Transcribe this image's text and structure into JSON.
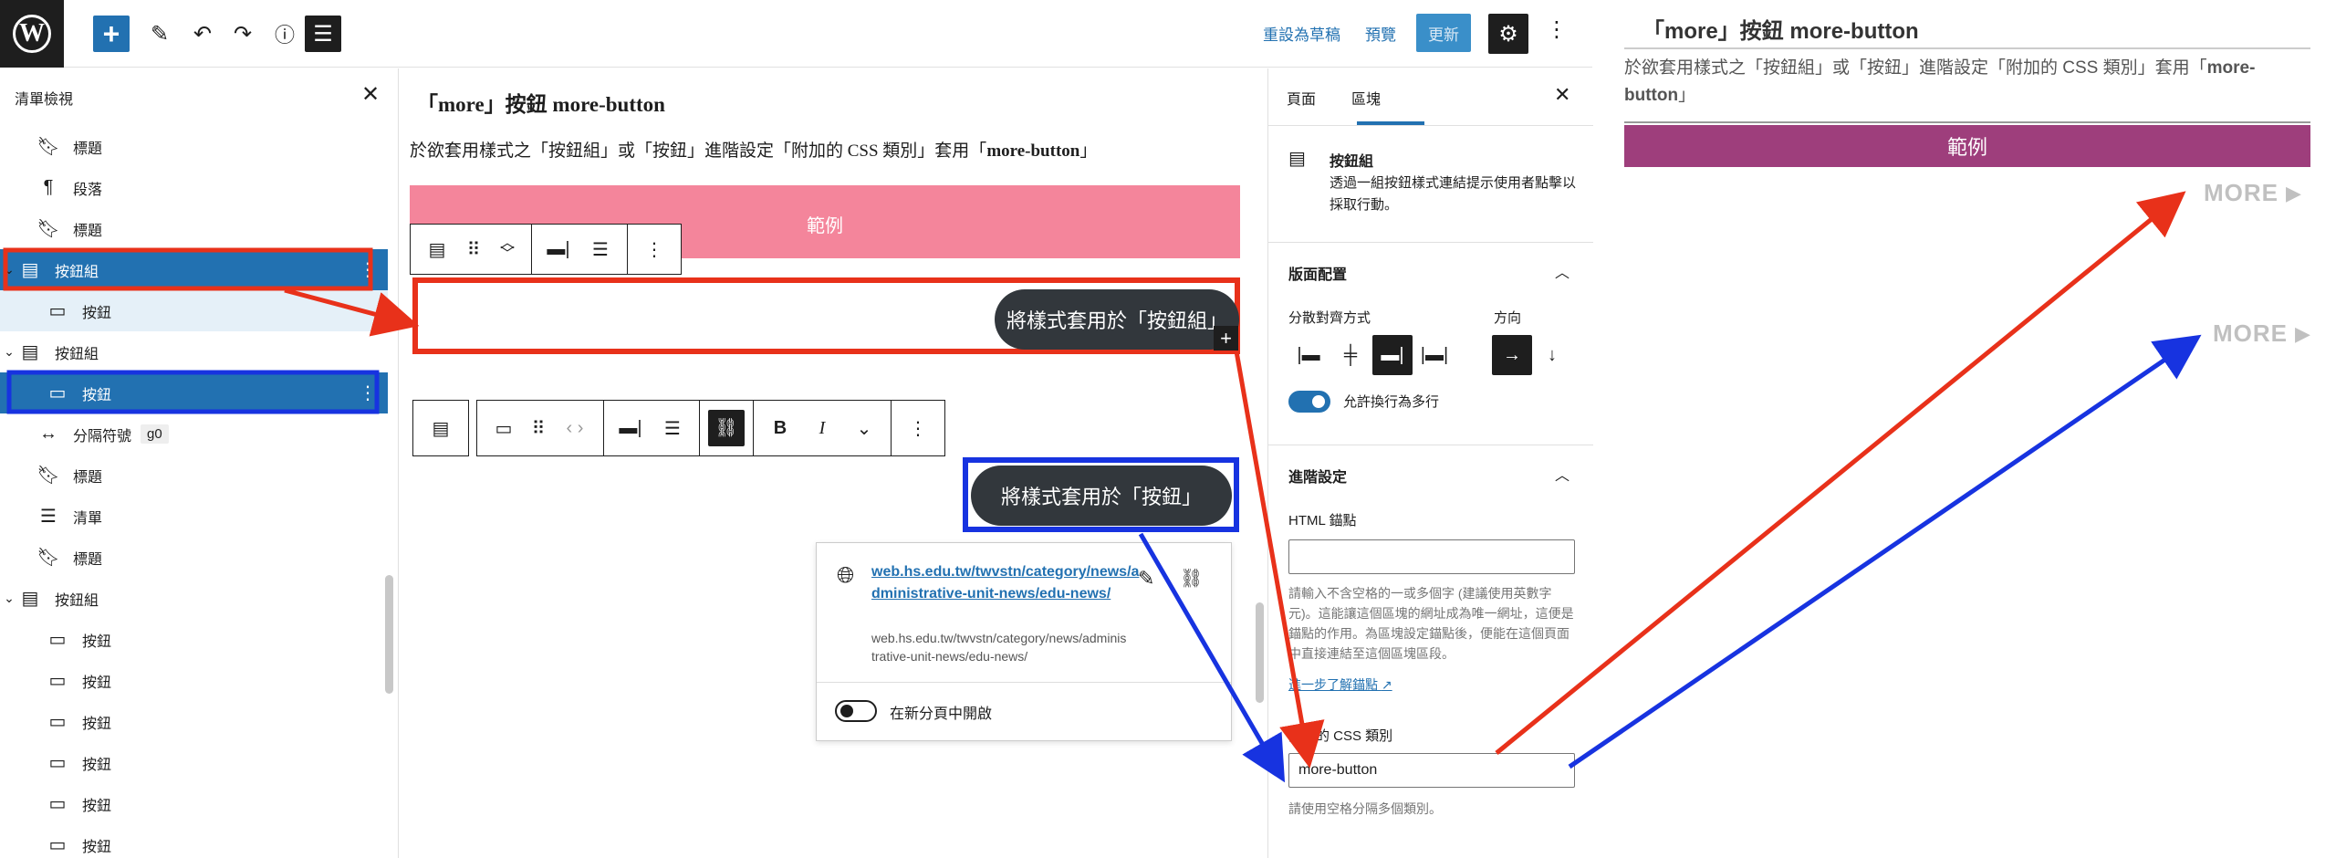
{
  "topbar": {
    "revert_draft": "重設為草稿",
    "preview": "預覽",
    "update": "更新"
  },
  "list_view": {
    "title": "清單檢視",
    "items": [
      {
        "label": "標題"
      },
      {
        "label": "段落"
      },
      {
        "label": "標題"
      },
      {
        "label": "按鈕組"
      },
      {
        "label": "按鈕"
      },
      {
        "label": "按鈕組"
      },
      {
        "label": "按鈕"
      },
      {
        "label": "分隔符號",
        "tag": "g0"
      },
      {
        "label": "標題"
      },
      {
        "label": "清單"
      },
      {
        "label": "標題"
      },
      {
        "label": "按鈕組"
      },
      {
        "label": "按鈕"
      },
      {
        "label": "按鈕"
      },
      {
        "label": "按鈕"
      },
      {
        "label": "按鈕"
      },
      {
        "label": "按鈕"
      },
      {
        "label": "按鈕"
      }
    ]
  },
  "editor": {
    "heading": "「more」按鈕 more-button",
    "paragraph_before": "於欲套用樣式之「按鈕組」或「按鈕」進階設定「附加的 CSS 類別」套用「",
    "paragraph_bold": "more-button",
    "paragraph_after": "」",
    "example_label": "範例",
    "button_group_label": "將樣式套用於「按鈕組」",
    "button_label": "將樣式套用於「按鈕」",
    "link_url": "web.hs.edu.tw/twvstn/category/news/administrative-unit-news/edu-news/",
    "link_url_sub": "web.hs.edu.tw/twvstn/category/news/administrative-unit-news/edu-news/",
    "new_tab_label": "在新分頁中開啟"
  },
  "settings": {
    "tab_page": "頁面",
    "tab_block": "區塊",
    "block_name": "按鈕組",
    "block_desc": "透過一組按鈕樣式連結提示使用者點擊以採取行動。",
    "layout_title": "版面配置",
    "justification_label": "分散對齊方式",
    "orientation_label": "方向",
    "allow_wrap_label": "允許換行為多行",
    "advanced_title": "進階設定",
    "html_anchor_label": "HTML 錨點",
    "html_anchor_value": "",
    "anchor_help": "請輸入不含空格的一或多個字 (建議使用英數字元)。這能讓這個區塊的網址成為唯一網址，這便是錨點的作用。為區塊設定錨點後，便能在這個頁面中直接連結至這個區塊區段。",
    "anchor_learn_more": "進一步了解錨點",
    "css_class_label": "附加的 CSS 類別",
    "css_class_value": "more-button",
    "css_class_help": "請使用空格分隔多個類別。"
  },
  "preview": {
    "heading": "「more」按鈕 more-button",
    "paragraph_before": "於欲套用樣式之「按鈕組」或「按鈕」進階設定「附加的 CSS 類別」套用「",
    "paragraph_bold": "more-button",
    "paragraph_after": "」",
    "example_label": "範例",
    "more_label_1": "MORE",
    "more_label_2": "MORE"
  },
  "annotation_colors": {
    "red": "#e8311a",
    "blue": "#1733e0"
  }
}
